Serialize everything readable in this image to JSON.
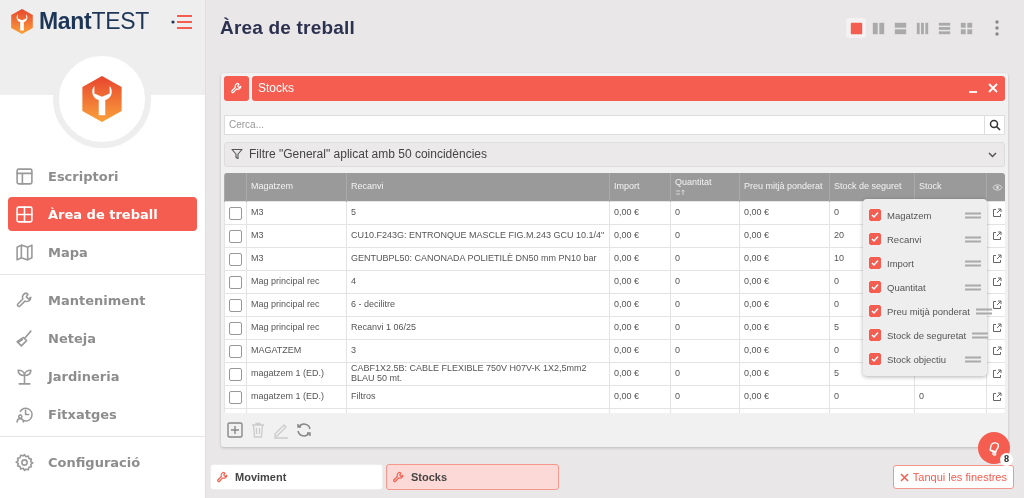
{
  "brand": {
    "name_bold": "Mant",
    "name_light": "TEST"
  },
  "sidebar": {
    "sections": [
      [
        {
          "label": "Escriptori",
          "kind": "layout",
          "selected": false
        },
        {
          "label": "Àrea de treball",
          "kind": "grid",
          "selected": true
        },
        {
          "label": "Mapa",
          "kind": "map",
          "selected": false
        }
      ],
      [
        {
          "label": "Manteniment",
          "kind": "wrench",
          "selected": false
        },
        {
          "label": "Neteja",
          "kind": "brush",
          "selected": false
        },
        {
          "label": "Jardineria",
          "kind": "plant",
          "selected": false
        },
        {
          "label": "Fitxatges",
          "kind": "clock",
          "selected": false
        }
      ],
      [
        {
          "label": "Configuració",
          "kind": "gear",
          "selected": false
        }
      ]
    ]
  },
  "page_title": "Àrea de treball",
  "layouts": [
    {
      "kind": "single",
      "selected": true
    },
    {
      "kind": "cols2",
      "selected": false
    },
    {
      "kind": "rows2",
      "selected": false
    },
    {
      "kind": "cols3",
      "selected": false
    },
    {
      "kind": "rows3",
      "selected": false
    },
    {
      "kind": "grid",
      "selected": false
    }
  ],
  "window": {
    "title": "Stocks"
  },
  "search": {
    "placeholder": "Cerca..."
  },
  "filter": {
    "text": "Filtre \"General\" aplicat amb 50 coincidències"
  },
  "table": {
    "columns": [
      {
        "label": "Magatzem"
      },
      {
        "label": "Recanvi"
      },
      {
        "label": "Import"
      },
      {
        "label": "Quantitat",
        "sortable": true
      },
      {
        "label": "Preu mitjà ponderat"
      },
      {
        "label": "Stock de seguret"
      },
      {
        "label": "Stock"
      }
    ],
    "rows": [
      {
        "checked": false,
        "cells": [
          "M3",
          "5",
          "0,00 €",
          "0",
          "0,00 €",
          "0"
        ]
      },
      {
        "checked": false,
        "cells": [
          "M3",
          "CU10.F243G: ENTRONQUE MASCLE FIG.M.243 GCU 10.1/4\"",
          "0,00 €",
          "0",
          "0,00 €",
          "20"
        ]
      },
      {
        "checked": false,
        "cells": [
          "M3",
          "GENTUBPL50: CANONADA POLIETILÈ DN50 mm PN10 bar",
          "0,00 €",
          "0",
          "0,00 €",
          "10"
        ]
      },
      {
        "checked": false,
        "cells": [
          "Mag principal rec",
          "4",
          "0,00 €",
          "0",
          "0,00 €",
          "0"
        ]
      },
      {
        "checked": false,
        "cells": [
          "Mag principal rec",
          "6 - decilitre",
          "0,00 €",
          "0",
          "0,00 €",
          "0"
        ]
      },
      {
        "checked": false,
        "cells": [
          "Mag principal rec",
          "Recanvi 1 06/25",
          "0,00 €",
          "0",
          "0,00 €",
          "5"
        ]
      },
      {
        "checked": false,
        "cells": [
          "MAGATZEM",
          "3",
          "0,00 €",
          "0",
          "0,00 €",
          "0"
        ]
      },
      {
        "checked": false,
        "cells": [
          "magatzem 1 (ED.)",
          "CABF1X2.5B: CABLE FLEXIBLE 750V H07V-K 1X2,5mm2 BLAU 50 mt.",
          "0,00 €",
          "0",
          "0,00 €",
          "5"
        ]
      },
      {
        "checked": false,
        "cells": [
          "magatzem 1 (ED.)",
          "Filtros",
          "0,00 €",
          "0",
          "0,00 €",
          "0",
          "0"
        ]
      }
    ]
  },
  "column_menu": [
    {
      "label": "Magatzem",
      "checked": true
    },
    {
      "label": "Recanvi",
      "checked": true
    },
    {
      "label": "Import",
      "checked": true
    },
    {
      "label": "Quantitat",
      "checked": true
    },
    {
      "label": "Preu mitjà ponderat",
      "checked": true
    },
    {
      "label": "Stock de seguretat",
      "checked": true
    },
    {
      "label": "Stock objectiu",
      "checked": true
    }
  ],
  "toolbar": [
    {
      "kind": "add",
      "disabled": false
    },
    {
      "kind": "delete",
      "disabled": true
    },
    {
      "kind": "edit",
      "disabled": true
    },
    {
      "kind": "refresh",
      "disabled": false
    }
  ],
  "taskbar": [
    {
      "label": "Moviment",
      "selected": false
    },
    {
      "label": "Stocks",
      "selected": true
    }
  ],
  "close_all": "Tanqui les finestres",
  "notifications": {
    "count": "8"
  }
}
